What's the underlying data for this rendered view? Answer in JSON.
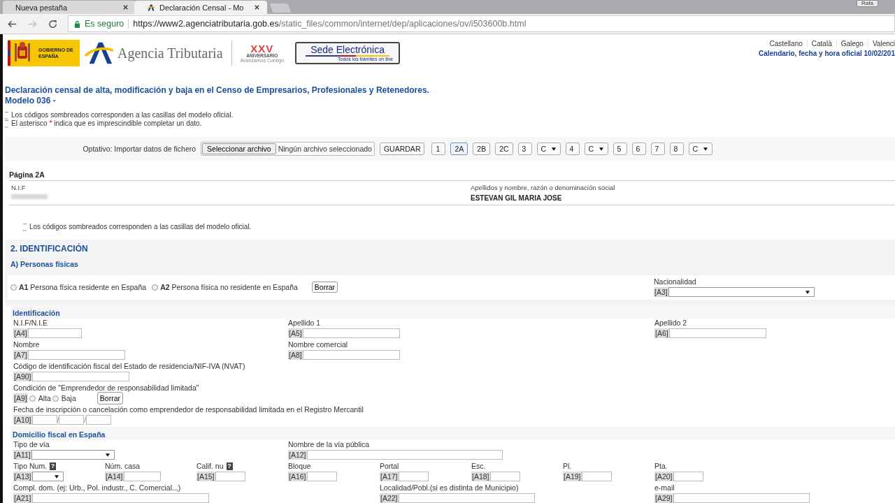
{
  "browser": {
    "tabs": [
      {
        "title": "Nueva pestaña",
        "selected": false
      },
      {
        "title": "Declaración Censal - Mo",
        "selected": true
      }
    ],
    "profile": "Rafa",
    "address": {
      "security": "Es seguro",
      "host": "https://www2.agenciatributaria.gob.es",
      "path": "/static_files/common/internet/dep/aplicaciones/ov/i503600b.html"
    }
  },
  "header": {
    "gov_logo": "GOBIERNO DE ESPAÑA",
    "agency": "Agencia Tributaria",
    "anniversary": {
      "numeral": "XXV",
      "word": "ANIVERSARIO",
      "tagline": "Avanzamos Contigo"
    },
    "sede": {
      "title": "Sede Electrónica",
      "subtitle": "Todos los trámites on line"
    },
    "languages": [
      "Castellano",
      "Català",
      "Galego",
      "Valenci"
    ],
    "calendar": "Calendario, fecha y hora oficial 10/02/201"
  },
  "title": [
    "Declaración censal de alta, modificación y baja en el Censo de Empresarios, Profesionales y Retenedores.",
    "Modelo 036 -"
  ],
  "notes": [
    {
      "before": "Los códigos sombreados corresponden a las casillas del modelo oficial."
    },
    {
      "before": "El asterisco",
      "mark": "*",
      "after": "indica que es imprescindible completar un dato."
    }
  ],
  "toolbar": {
    "label": "Optativo: Importar datos de fichero",
    "file_button": "Seleccionar archivo",
    "file_status": "Ningún archivo seleccionado",
    "items": [
      {
        "kind": "button",
        "label": "GUARDAR",
        "selected": false
      },
      {
        "kind": "button",
        "label": "1",
        "selected": false
      },
      {
        "kind": "button",
        "label": "2A",
        "selected": true
      },
      {
        "kind": "button",
        "label": "2B",
        "selected": false
      },
      {
        "kind": "button",
        "label": "2C",
        "selected": false
      },
      {
        "kind": "button",
        "label": "3",
        "selected": false
      },
      {
        "kind": "select",
        "label": "C",
        "selected": false
      },
      {
        "kind": "button",
        "label": "4",
        "selected": false
      },
      {
        "kind": "select",
        "label": "C",
        "selected": false
      },
      {
        "kind": "button",
        "label": "5",
        "selected": false
      },
      {
        "kind": "button",
        "label": "6",
        "selected": false
      },
      {
        "kind": "button",
        "label": "7",
        "selected": false
      },
      {
        "kind": "button",
        "label": "8",
        "selected": false
      },
      {
        "kind": "select",
        "label": "C",
        "selected": false
      }
    ]
  },
  "page": {
    "title": "Página 2A",
    "nif_label": "N.I.F",
    "name_label": "Apellidos y nombre, razón o denominación social",
    "name_value": "ESTEVAN GIL MARIA JOSE"
  },
  "note_repeat": "Los códigos sombreados corresponden a las casillas del modelo oficial.",
  "section": {
    "title": "2. IDENTIFICACIÓN",
    "subtitle": "A) Personas físicas",
    "residence": [
      {
        "code": "A1",
        "label": "Persona física residente en España",
        "selected": false
      },
      {
        "code": "A2",
        "label": "Persona física no residente en España",
        "selected": false
      }
    ],
    "clear": "Borrar",
    "nationality": {
      "label": "Nacionalidad",
      "code": "[A3]",
      "kind": "select"
    }
  },
  "groups": [
    {
      "title": "Identificación",
      "rows": [
        [
          {
            "kind": "text",
            "label": "N.I.F/N.I.E",
            "code": "[A4]"
          },
          "",
          "",
          {
            "kind": "text",
            "label": "Apellido 1",
            "code": "[A5]"
          },
          "",
          "",
          "",
          {
            "kind": "text",
            "label": "Apellido 2",
            "code": "[A6]"
          }
        ],
        [
          {
            "kind": "text",
            "label": "Nombre",
            "code": "[A7]"
          },
          "",
          "",
          {
            "kind": "text",
            "label": "Nombre comercial",
            "code": "[A8]"
          }
        ],
        [
          {
            "kind": "text",
            "label": "Código de identificación fiscal del Estado de residencia/NIF-IVA (NVAT)",
            "code": "[A90]"
          }
        ],
        [
          {
            "kind": "radio",
            "label": "Condición de \"Emprendedor de responsabilidad limitada\"",
            "code": "[A9]",
            "options": [
              {
                "label": "Alta",
                "selected": false
              },
              {
                "label": "Baja",
                "selected": false
              }
            ],
            "clear": "Borrar"
          }
        ],
        [
          {
            "kind": "date",
            "label": "Fecha de inscripción o cancelación como emprendedor de responsabilidad limitada en el Registro Mercantil",
            "code": "[A10]",
            "separator": "/"
          }
        ]
      ]
    },
    {
      "title": "Domicilio fiscal en España",
      "rows": [
        [
          {
            "kind": "select",
            "label": "Tipo de vía",
            "code": "[A11]"
          },
          "",
          "",
          {
            "kind": "text",
            "label": "Nombre de la vía pública",
            "code": "[A12]"
          }
        ],
        [
          {
            "kind": "select",
            "label": "Tipo Num.",
            "code": "[A13]",
            "help": "?"
          },
          {
            "kind": "text",
            "label": "Núm. casa",
            "code": "[A14]"
          },
          {
            "kind": "text",
            "label": "Calif. nu",
            "code": "[A15]",
            "help": "?"
          },
          {
            "kind": "text",
            "label": "Bloque",
            "code": "[A16]"
          },
          {
            "kind": "text",
            "label": "Portal",
            "code": "[A17]"
          },
          {
            "kind": "text",
            "label": "Esc.",
            "code": "[A18]"
          },
          {
            "kind": "text",
            "label": "Pl.",
            "code": "[A19]"
          },
          {
            "kind": "text",
            "label": "Pta.",
            "code": "[A20]"
          }
        ],
        [
          {
            "kind": "text",
            "label": "Compl. dom. (ej: Urb., Pol. industr., C. Comercial..,)",
            "code": "[A21]"
          },
          "",
          "",
          "",
          {
            "kind": "text",
            "label": "Localidad/Pobl.(si es distinta de Municipio)",
            "code": "[A22]"
          },
          "",
          "",
          {
            "kind": "text",
            "label": "e-mail",
            "code": "[A29]"
          }
        ]
      ]
    }
  ]
}
